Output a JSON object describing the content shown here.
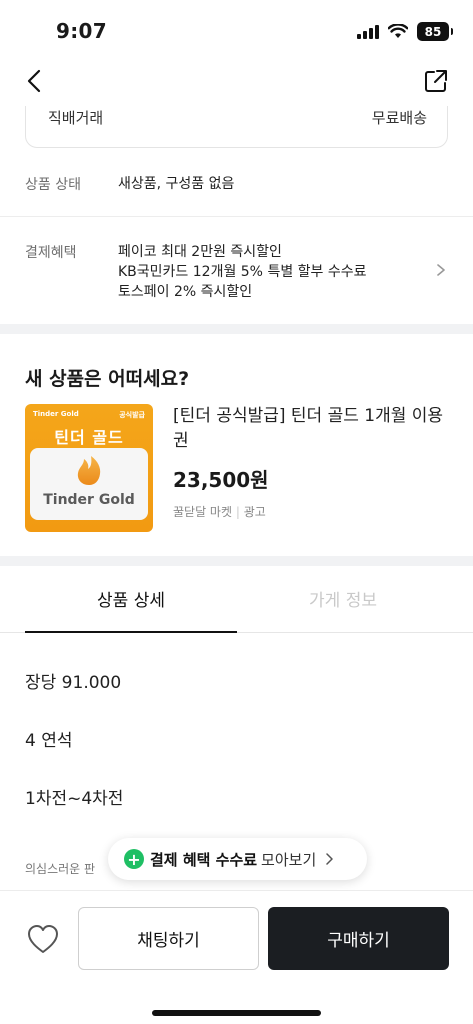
{
  "status": {
    "time": "9:07",
    "battery": "85"
  },
  "peek_card": {
    "left": "직배거래",
    "right": "무료배송"
  },
  "info": {
    "condition_label": "상품 상태",
    "condition_value": "새상품, 구성품 없음",
    "benefit_label": "결제혜택",
    "benefit_lines": [
      "페이코 최대 2만원 즉시할인",
      "KB국민카드 12개월 5% 특별 할부 수수료",
      "토스페이 2% 즉시할인"
    ]
  },
  "recommend": {
    "title": "새 상품은 어떠세요?",
    "image": {
      "top_left": "Tinder Gold",
      "top_right": "공식발급",
      "title": "틴더 골드",
      "brand": "Tinder Gold"
    },
    "name": "[틴더 공식발급] 틴더 골드 1개월 이용권",
    "price": "23,500원",
    "seller": "꿀닫달 마켓",
    "ad": "광고"
  },
  "tabs": {
    "detail": "상품 상세",
    "store": "가게 정보"
  },
  "description": [
    "장당 91.000",
    "4 연석",
    "1차전~4차전"
  ],
  "description_faded": "의심스러운 판",
  "benefit_pill": {
    "bold": "결제 혜택 수수료",
    "normal": "모아보기"
  },
  "actions": {
    "chat": "채팅하기",
    "buy": "구매하기"
  },
  "colors": {
    "accent_green": "#1fbf64",
    "buy_button": "#1b1e22",
    "tinder_orange": "#f4a61a"
  },
  "icons": [
    "back-arrow-icon",
    "share-icon",
    "chevron-right-icon",
    "plus-icon",
    "heart-icon",
    "tinder-flame-icon"
  ]
}
